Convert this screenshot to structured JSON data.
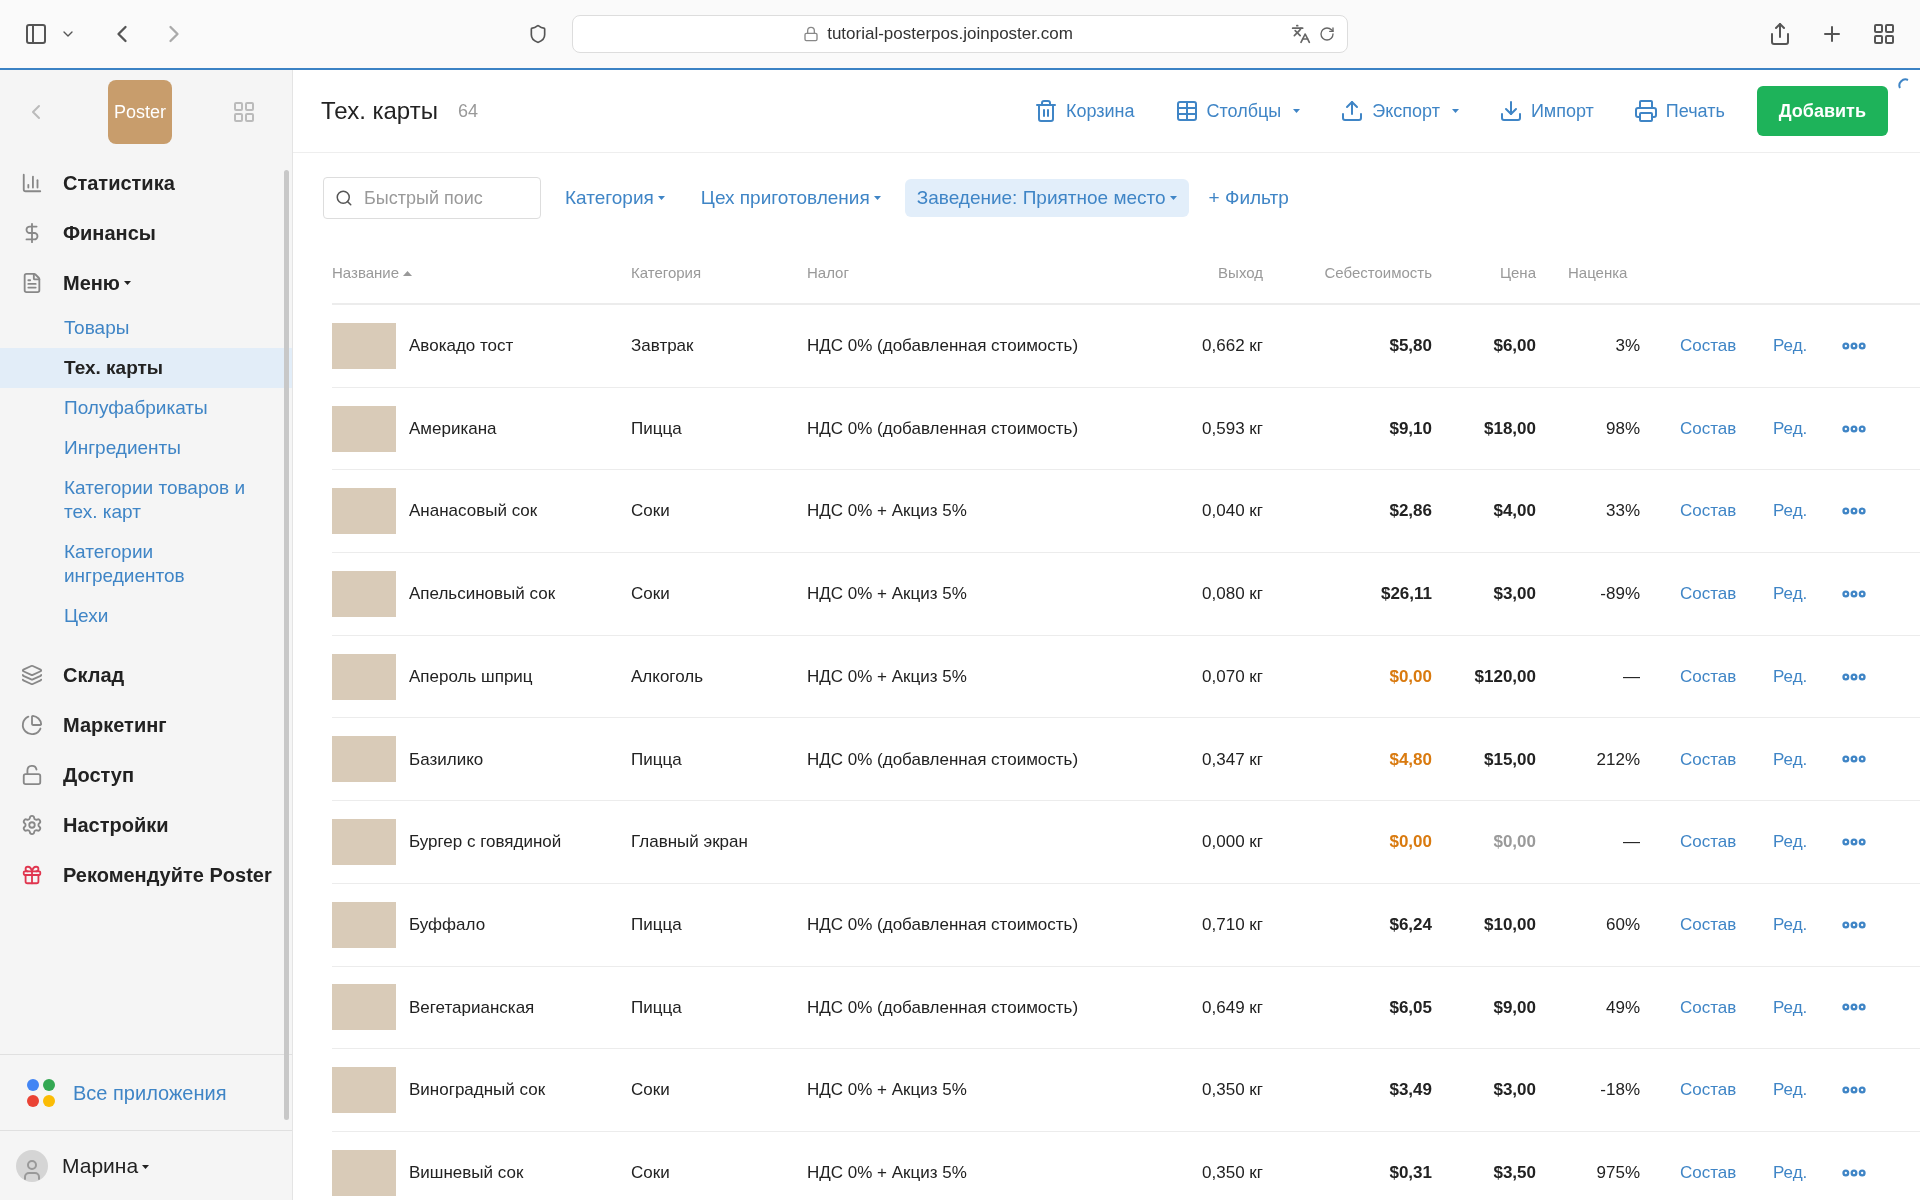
{
  "browser": {
    "url": "tutorial-posterpos.joinposter.com"
  },
  "sidebar": {
    "logo": "Poster",
    "items": [
      {
        "label": "Статистика",
        "kind": "stats",
        "expanded": false
      },
      {
        "label": "Финансы",
        "kind": "finance",
        "expanded": false
      },
      {
        "label": "Меню",
        "kind": "menu",
        "expanded": true,
        "children": [
          {
            "label": "Товары",
            "selected": false
          },
          {
            "label": "Тех. карты",
            "selected": true
          },
          {
            "label": "Полуфабрикаты",
            "selected": false
          },
          {
            "label": "Ингредиенты",
            "selected": false
          },
          {
            "label": "Категории товаров и тех. карт",
            "selected": false
          },
          {
            "label": "Категории ингредиентов",
            "selected": false
          },
          {
            "label": "Цехи",
            "selected": false
          }
        ]
      },
      {
        "label": "Склад",
        "kind": "stock",
        "expanded": false
      },
      {
        "label": "Маркетинг",
        "kind": "marketing",
        "expanded": false
      },
      {
        "label": "Доступ",
        "kind": "access",
        "expanded": false
      },
      {
        "label": "Настройки",
        "kind": "settings",
        "expanded": false
      },
      {
        "label": "Рекомендуйте Poster",
        "kind": "gift",
        "expanded": false
      }
    ],
    "all_apps": "Все приложения",
    "user": "Марина"
  },
  "header": {
    "title": "Тех. карты",
    "count": "64",
    "actions": [
      {
        "label": "Корзина",
        "kind": "trash",
        "dropdown": false
      },
      {
        "label": "Столбцы",
        "kind": "columns",
        "dropdown": true
      },
      {
        "label": "Экспорт",
        "kind": "export",
        "dropdown": true
      },
      {
        "label": "Импорт",
        "kind": "import",
        "dropdown": false
      },
      {
        "label": "Печать",
        "kind": "print",
        "dropdown": false
      }
    ],
    "add_button": "Добавить"
  },
  "filters": {
    "search_placeholder": "Быстрый поис",
    "items": [
      {
        "label": "Категория",
        "active": false
      },
      {
        "label": "Цех приготовления",
        "active": false
      },
      {
        "label": "Заведение: Приятное место",
        "active": true
      }
    ],
    "add_filter": "+ Фильтр"
  },
  "table": {
    "columns": [
      {
        "label": "Название",
        "sorted": true
      },
      {
        "label": "Категория",
        "sorted": false
      },
      {
        "label": "Налог",
        "sorted": false
      },
      {
        "label": "Выход",
        "sorted": false
      },
      {
        "label": "Себестоимость",
        "sorted": false
      },
      {
        "label": "Цена",
        "sorted": false
      },
      {
        "label": "Наценка",
        "sorted": false
      }
    ],
    "rows": [
      {
        "name": "Авокадо тост",
        "category": "Завтрак",
        "tax": "НДС 0% (добавленная стоимость)",
        "output": "0,662 кг",
        "cost": "$5,80",
        "cost_warning": false,
        "price": "$6,00",
        "price_muted": false,
        "markup": "3%",
        "links": [
          "Состав",
          "Ред."
        ]
      },
      {
        "name": "Американа",
        "category": "Пицца",
        "tax": "НДС 0% (добавленная стоимость)",
        "output": "0,593 кг",
        "cost": "$9,10",
        "cost_warning": false,
        "price": "$18,00",
        "price_muted": false,
        "markup": "98%",
        "links": [
          "Состав",
          "Ред."
        ]
      },
      {
        "name": "Ананасовый сок",
        "category": "Соки",
        "tax": "НДС 0% + Акциз 5%",
        "output": "0,040 кг",
        "cost": "$2,86",
        "cost_warning": false,
        "price": "$4,00",
        "price_muted": false,
        "markup": "33%",
        "links": [
          "Состав",
          "Ред."
        ]
      },
      {
        "name": "Апельсиновый сок",
        "category": "Соки",
        "tax": "НДС 0% + Акциз 5%",
        "output": "0,080 кг",
        "cost": "$26,11",
        "cost_warning": false,
        "price": "$3,00",
        "price_muted": false,
        "markup": "-89%",
        "links": [
          "Состав",
          "Ред."
        ]
      },
      {
        "name": "Апероль шприц",
        "category": "Алкоголь",
        "tax": "НДС 0% + Акциз 5%",
        "output": "0,070 кг",
        "cost": "$0,00",
        "cost_warning": true,
        "price": "$120,00",
        "price_muted": false,
        "markup": "—",
        "links": [
          "Состав",
          "Ред."
        ]
      },
      {
        "name": "Базилико",
        "category": "Пицца",
        "tax": "НДС 0% (добавленная стоимость)",
        "output": "0,347 кг",
        "cost": "$4,80",
        "cost_warning": true,
        "price": "$15,00",
        "price_muted": false,
        "markup": "212%",
        "links": [
          "Состав",
          "Ред."
        ]
      },
      {
        "name": "Бургер с говядиной",
        "category": "Главный экран",
        "output": "0,000 кг",
        "cost": "$0,00",
        "cost_warning": true,
        "price": "$0,00",
        "price_muted": true,
        "markup": "—",
        "links": [
          "Состав",
          "Ред."
        ]
      },
      {
        "name": "Буффало",
        "category": "Пицца",
        "tax": "НДС 0% (добавленная стоимость)",
        "output": "0,710 кг",
        "cost": "$6,24",
        "cost_warning": false,
        "price": "$10,00",
        "price_muted": false,
        "markup": "60%",
        "links": [
          "Состав",
          "Ред."
        ]
      },
      {
        "name": "Вегетарианская",
        "category": "Пицца",
        "tax": "НДС 0% (добавленная стоимость)",
        "output": "0,649 кг",
        "cost": "$6,05",
        "cost_warning": false,
        "price": "$9,00",
        "price_muted": false,
        "markup": "49%",
        "links": [
          "Состав",
          "Ред."
        ]
      },
      {
        "name": "Виноградный сок",
        "category": "Соки",
        "tax": "НДС 0% + Акциз 5%",
        "output": "0,350 кг",
        "cost": "$3,49",
        "cost_warning": false,
        "price": "$3,00",
        "price_muted": false,
        "markup": "-18%",
        "links": [
          "Состав",
          "Ред."
        ]
      },
      {
        "name": "Вишневый сок",
        "category": "Соки",
        "tax": "НДС 0% + Акциз 5%",
        "output": "0,350 кг",
        "cost": "$0,31",
        "cost_warning": false,
        "price": "$3,50",
        "price_muted": false,
        "markup": "975%",
        "links": [
          "Состав",
          "Ред."
        ]
      }
    ]
  }
}
